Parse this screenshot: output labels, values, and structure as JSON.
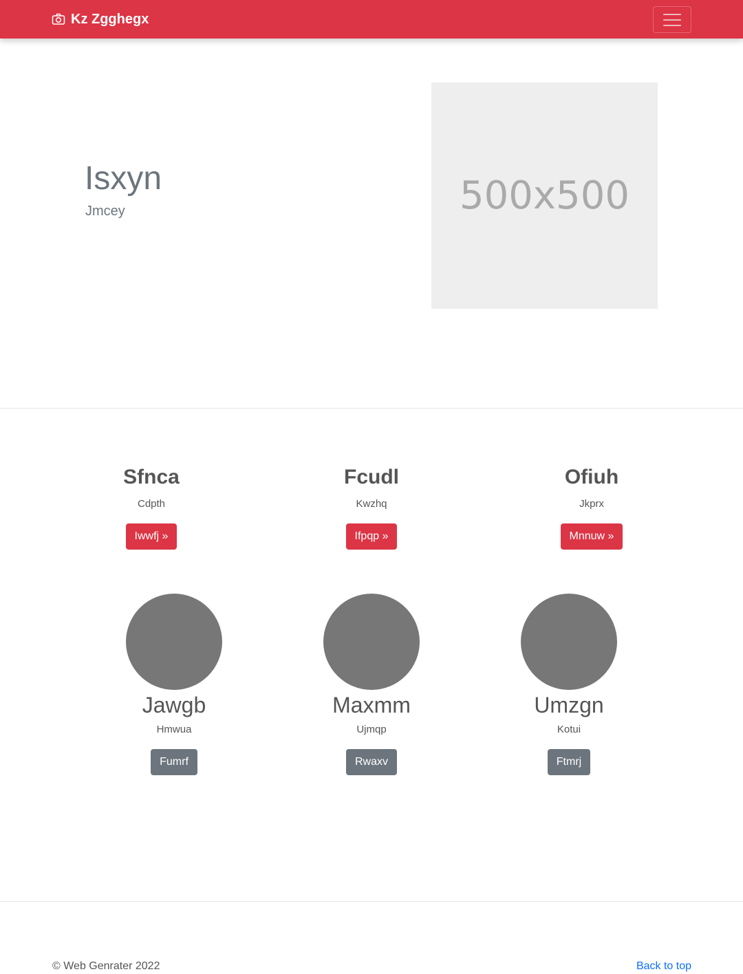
{
  "navbar": {
    "brand": "Kz Zgghegx",
    "brand_icon": "camera-icon",
    "menu_icon": "hamburger-icon",
    "color": "#dc3545"
  },
  "hero": {
    "title": "Isxyn",
    "subtitle": "Jmcey",
    "image_label": "500x500"
  },
  "features": [
    {
      "title": "Sfnca",
      "text": "Cdpth",
      "button": "Iwwfj »"
    },
    {
      "title": "Fcudl",
      "text": "Kwzhq",
      "button": "Ifpqp »"
    },
    {
      "title": "Ofiuh",
      "text": "Jkprx",
      "button": "Mnnuw »"
    }
  ],
  "people": [
    {
      "name": "Jawgb",
      "text": "Hmwua",
      "button": "Fumrf"
    },
    {
      "name": "Maxmm",
      "text": "Ujmqp",
      "button": "Rwaxv"
    },
    {
      "name": "Umzgn",
      "text": "Kotui",
      "button": "Ftmrj"
    }
  ],
  "footer": {
    "copyright": "© Web Genrater 2022",
    "back_to_top": "Back to top",
    "link_color": "#0d6efd"
  }
}
